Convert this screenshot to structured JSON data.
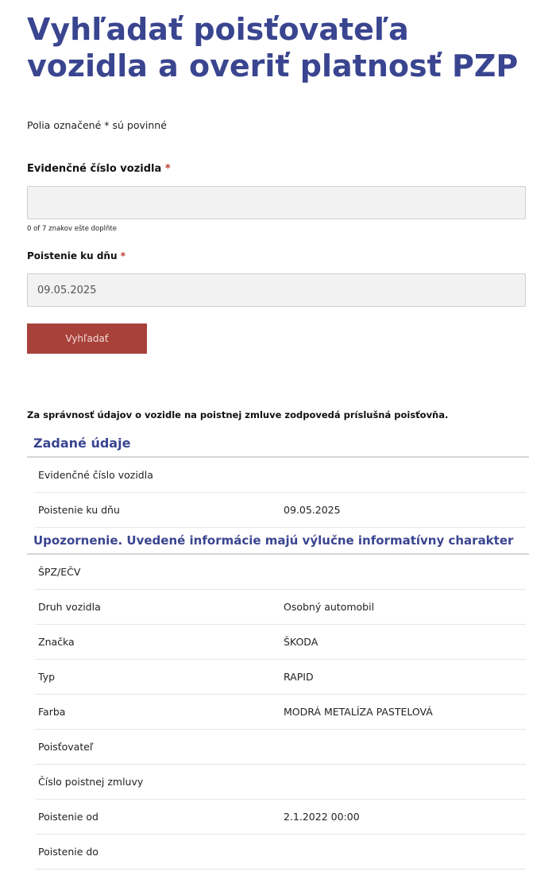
{
  "page": {
    "title": "Vyhľadať poisťovateľa vozidla a overiť platnosť PZP"
  },
  "form": {
    "required_note": "Polia označené * sú povinné",
    "star": "*",
    "plate_label": "Evidenčné číslo vozidla",
    "plate_value": "",
    "char_counter": "0 of 7 znakov ešte doplňte",
    "date_label": "Poistenie ku dňu",
    "date_value": "09.05.2025",
    "submit_label": "Vyhľadať"
  },
  "results": {
    "disclaimer": "Za správnosť údajov o vozidle na poistnej zmluve zodpovedá príslušná poisťovňa.",
    "entered_heading": "Zadané údaje",
    "entered_rows": [
      {
        "label": "Evidenčné číslo vozidla",
        "value": ""
      },
      {
        "label": "Poistenie ku dňu",
        "value": "09.05.2025"
      }
    ],
    "warning_heading": "Upozornenie. Uvedené informácie majú výlučne informatívny charakter",
    "vehicle_rows": [
      {
        "label": "ŠPZ/EČV",
        "value": ""
      },
      {
        "label": "Druh vozidla",
        "value": "Osobný automobil"
      },
      {
        "label": "Značka",
        "value": "ŠKODA"
      },
      {
        "label": "Typ",
        "value": "RAPID"
      },
      {
        "label": "Farba",
        "value": "MODRÁ METALÍZA PASTELOVÁ"
      },
      {
        "label": "Poisťovateľ",
        "value": ""
      },
      {
        "label": "Číslo poistnej zmluvy",
        "value": ""
      },
      {
        "label": "Poistenie od",
        "value": "2.1.2022 00:00"
      },
      {
        "label": "Poistenie do",
        "value": ""
      }
    ]
  },
  "colors": {
    "title": "#3a4590",
    "button": "#a8413a",
    "required_star": "#c0392b",
    "input_bg": "#f2f2f2"
  }
}
